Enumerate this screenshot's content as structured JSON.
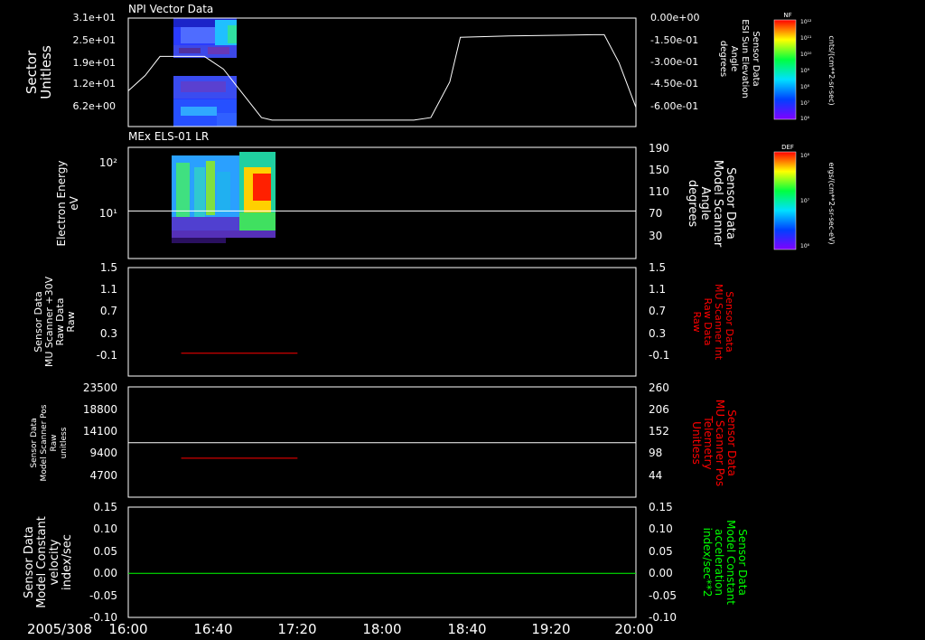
{
  "date_label": "2005/308",
  "x_ticks": [
    "16:00",
    "16:40",
    "17:20",
    "18:00",
    "18:40",
    "19:20",
    "20:00"
  ],
  "colors": {
    "trace": "#ffffff",
    "red": "#ff0000",
    "green": "#00ff00"
  },
  "chart_data": [
    {
      "type": "heatmap",
      "title": "NPI Vector Data",
      "ylabel_lines": [
        "Sector",
        "Unitless"
      ],
      "yticks_left": [
        "3.1e+01",
        "2.5e+01",
        "1.9e+01",
        "1.2e+01",
        "6.2e+00"
      ],
      "yticks_right": [
        "0.00e+00",
        "-1.50e-01",
        "-3.00e-01",
        "-4.50e-01",
        "-6.00e-01"
      ],
      "right_label_lines": [
        "Sensor Data",
        "ESI Sun Elevation",
        "Angle",
        "degrees"
      ],
      "colorbar": {
        "title": "NF",
        "unit": "cnts/(cm**2-sr-sec)",
        "ticks": [
          "10¹²",
          "10¹¹",
          "10¹⁰",
          "10⁹",
          "10⁸",
          "10⁷",
          "10⁶"
        ]
      },
      "heatmap_x_range": [
        "16:30",
        "17:00"
      ],
      "line_series": {
        "name": "ESI Sun Elevation Angle",
        "x": [
          "16:00",
          "16:08",
          "16:15",
          "16:36",
          "16:45",
          "17:03",
          "17:08",
          "18:15",
          "18:23",
          "18:32",
          "18:37",
          "19:00",
          "19:40",
          "19:45",
          "19:52",
          "20:00"
        ],
        "y": [
          -0.57,
          -0.45,
          -0.3,
          -0.3,
          -0.4,
          -0.78,
          -0.8,
          -0.8,
          -0.78,
          -0.5,
          -0.15,
          -0.14,
          -0.13,
          -0.13,
          -0.35,
          -0.7
        ]
      }
    },
    {
      "type": "heatmap",
      "title": "MEx ELS-01 LR",
      "ylabel_lines": [
        "Electron Energy",
        "eV"
      ],
      "yticks_left": [
        "10²",
        "10¹"
      ],
      "yticks_right": [
        "190",
        "150",
        "110",
        "70",
        "30"
      ],
      "right_label_lines": [
        "Sensor Data",
        "Model Scanner",
        "Angle",
        "degrees"
      ],
      "colorbar": {
        "title": "DEF",
        "unit": "ergs/(cm**2-sr-sec-eV)",
        "ticks": [
          "10⁸",
          "10⁷",
          "10⁶"
        ]
      },
      "heatmap_x_range": [
        "16:30",
        "17:20"
      ],
      "line_series": {
        "name": "Model Scanner Angle",
        "x": [
          "16:00",
          "20:00"
        ],
        "y": [
          87,
          87
        ]
      }
    },
    {
      "type": "line",
      "ylabel_lines": [
        "Sensor Data",
        "MU Scanner +30V",
        "Raw Data",
        "Raw"
      ],
      "yticks_left": [
        "1.5",
        "1.1",
        "0.7",
        "0.3",
        "-0.1"
      ],
      "yticks_right": [
        "1.5",
        "1.1",
        "0.7",
        "0.3",
        "-0.1"
      ],
      "right_label_lines": [
        "Sensor Data",
        "MU Scanner Int",
        "Raw Data",
        "Raw"
      ],
      "ylim": [
        -0.4,
        1.5
      ],
      "series": [
        {
          "x": [
            "16:25",
            "17:20"
          ],
          "y": [
            0.0,
            0.0
          ]
        }
      ]
    },
    {
      "type": "line",
      "ylabel_lines": [
        "Sensor Data",
        "Model Scanner Pos",
        "Raw",
        "unitless"
      ],
      "yticks_left": [
        "23500",
        "18800",
        "14100",
        "9400",
        "4700"
      ],
      "yticks_right": [
        "260",
        "206",
        "152",
        "98",
        "44"
      ],
      "right_label_lines": [
        "Sensor Data",
        "MU Scanner Pos",
        "Telemetry",
        "Unitless"
      ],
      "ylim": [
        0,
        23500
      ],
      "series": [
        {
          "x": [
            "16:00",
            "20:00"
          ],
          "y": [
            11600,
            11600
          ]
        },
        {
          "x": [
            "16:25",
            "17:20"
          ],
          "y": [
            8300,
            8300
          ]
        }
      ]
    },
    {
      "type": "line",
      "ylabel_lines": [
        "Sensor Data",
        "Model Constant",
        "velocity",
        "index/sec"
      ],
      "yticks_left": [
        "0.15",
        "0.10",
        "0.05",
        "0.00",
        "-0.05",
        "-0.10"
      ],
      "yticks_right": [
        "0.15",
        "0.10",
        "0.05",
        "0.00",
        "-0.05",
        "-0.10"
      ],
      "right_label_lines": [
        "Sensor Data",
        "Model Constant",
        "acceleration",
        "index/sec**2"
      ],
      "ylim": [
        -0.1,
        0.15
      ],
      "series": [
        {
          "x": [
            "16:00",
            "20:00"
          ],
          "y": [
            0.0,
            0.0
          ]
        }
      ]
    }
  ]
}
